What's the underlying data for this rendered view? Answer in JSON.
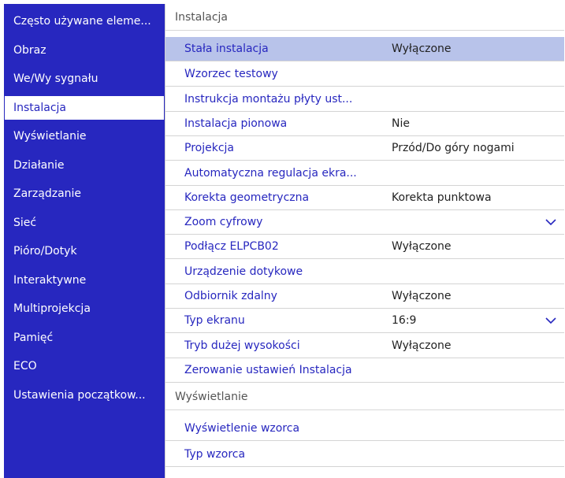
{
  "sidebar": {
    "items": [
      {
        "label": "Często używane eleme..."
      },
      {
        "label": "Obraz"
      },
      {
        "label": "We/Wy sygnału"
      },
      {
        "label": "Instalacja",
        "active": true
      },
      {
        "label": "Wyświetlanie"
      },
      {
        "label": "Działanie"
      },
      {
        "label": "Zarządzanie"
      },
      {
        "label": "Sieć"
      },
      {
        "label": "Pióro/Dotyk"
      },
      {
        "label": "Interaktywne"
      },
      {
        "label": "Multiprojekcja"
      },
      {
        "label": "Pamięć"
      },
      {
        "label": "ECO"
      },
      {
        "label": "Ustawienia początkow..."
      }
    ]
  },
  "main": {
    "section1": {
      "title": "Instalacja",
      "rows": [
        {
          "label": "Stała instalacja",
          "value": "Wyłączone",
          "selected": true
        },
        {
          "label": "Wzorzec testowy",
          "value": ""
        },
        {
          "label": "Instrukcja montażu płyty ust...",
          "value": ""
        },
        {
          "label": "Instalacja pionowa",
          "value": "Nie"
        },
        {
          "label": "Projekcja",
          "value": "Przód/Do góry nogami"
        },
        {
          "label": "Automatyczna regulacja ekra...",
          "value": ""
        },
        {
          "label": "Korekta geometryczna",
          "value": "Korekta punktowa"
        },
        {
          "label": "Zoom cyfrowy",
          "value": "",
          "expandable": true
        },
        {
          "label": "Podłącz ELPCB02",
          "value": "Wyłączone"
        },
        {
          "label": "Urządzenie dotykowe",
          "value": ""
        },
        {
          "label": "Odbiornik zdalny",
          "value": "Wyłączone"
        },
        {
          "label": "Typ ekranu",
          "value": "16:9",
          "expandable": true
        },
        {
          "label": "Tryb dużej wysokości",
          "value": "Wyłączone"
        },
        {
          "label": "Zerowanie ustawień Instalacja",
          "value": ""
        }
      ]
    },
    "section2": {
      "title": "Wyświetlanie",
      "rows": [
        {
          "label": "Wyświetlenie wzorca",
          "value": ""
        },
        {
          "label": "Typ wzorca",
          "value": ""
        }
      ]
    }
  },
  "colors": {
    "sidebar_bg": "#2727bf",
    "item_text": "#2727bf",
    "selected_row_bg": "#b8c3ea"
  },
  "icons": {
    "expand": "chevron-down-icon"
  }
}
